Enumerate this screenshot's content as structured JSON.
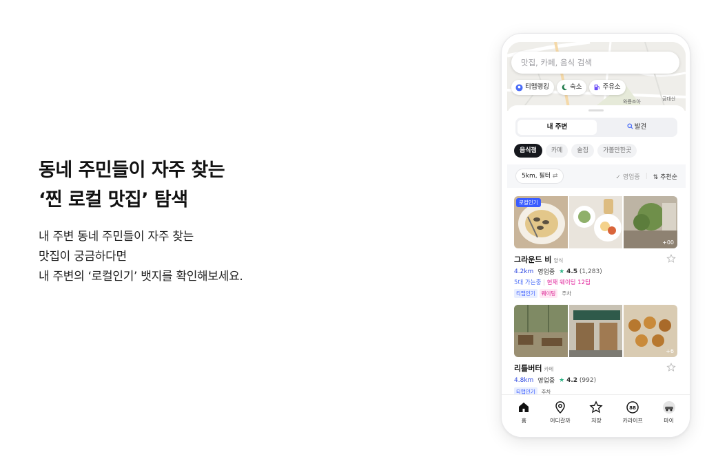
{
  "promo": {
    "headline_line1": "동네 주민들이 자주 찾는",
    "headline_line2": "‘찐 로컬 맛집’ 탐색",
    "desc_line1": "내 주변 동네 주민들이 자주 찾는",
    "desc_line2": "맛집이 궁금하다면",
    "desc_line3": "내 주변의 ‘로컬인기’ 뱃지를 확인해보세요."
  },
  "app": {
    "search_placeholder": "맛집, 카페, 음식 검색",
    "map_chips": [
      {
        "label": "티맵랭킹",
        "icon": "location-pin-icon"
      },
      {
        "label": "숙소",
        "icon": "moon-icon"
      },
      {
        "label": "주유소",
        "icon": "fuel-icon"
      }
    ],
    "map_labels": [
      "와룡조아",
      "금대산"
    ],
    "segment": {
      "active": "내 주변",
      "other": "발견"
    },
    "categories": [
      "음식점",
      "카페",
      "술집",
      "가볼만한곳"
    ],
    "filter": {
      "button": "5km, 필터",
      "open_now": "영업중",
      "sort": "추천순"
    },
    "places": [
      {
        "name": "그라운드 비",
        "type": "양식",
        "badge": "로컬인기",
        "more_photos": "+00",
        "distance": "4.2km",
        "status": "영업중",
        "rating": "4.5",
        "reviews": "(1,283)",
        "waiting_left": "5대 가는중",
        "waiting_right": "현재 웨이팅 12팀",
        "tags": [
          "티맵인기",
          "웨이팅",
          "주차"
        ]
      },
      {
        "name": "리틀버터",
        "type": "카페",
        "more_photos": "+6",
        "distance": "4.8km",
        "status": "영업중",
        "rating": "4.2",
        "reviews": "(992)",
        "tags": [
          "티맵인기",
          "주차"
        ]
      }
    ],
    "tabs": [
      {
        "label": "홈",
        "icon": "home-icon"
      },
      {
        "label": "어디갈까",
        "icon": "map-pin-icon"
      },
      {
        "label": "저장",
        "icon": "star-icon"
      },
      {
        "label": "카라이프",
        "icon": "car-life-icon"
      },
      {
        "label": "마이",
        "icon": "profile-icon"
      }
    ]
  }
}
